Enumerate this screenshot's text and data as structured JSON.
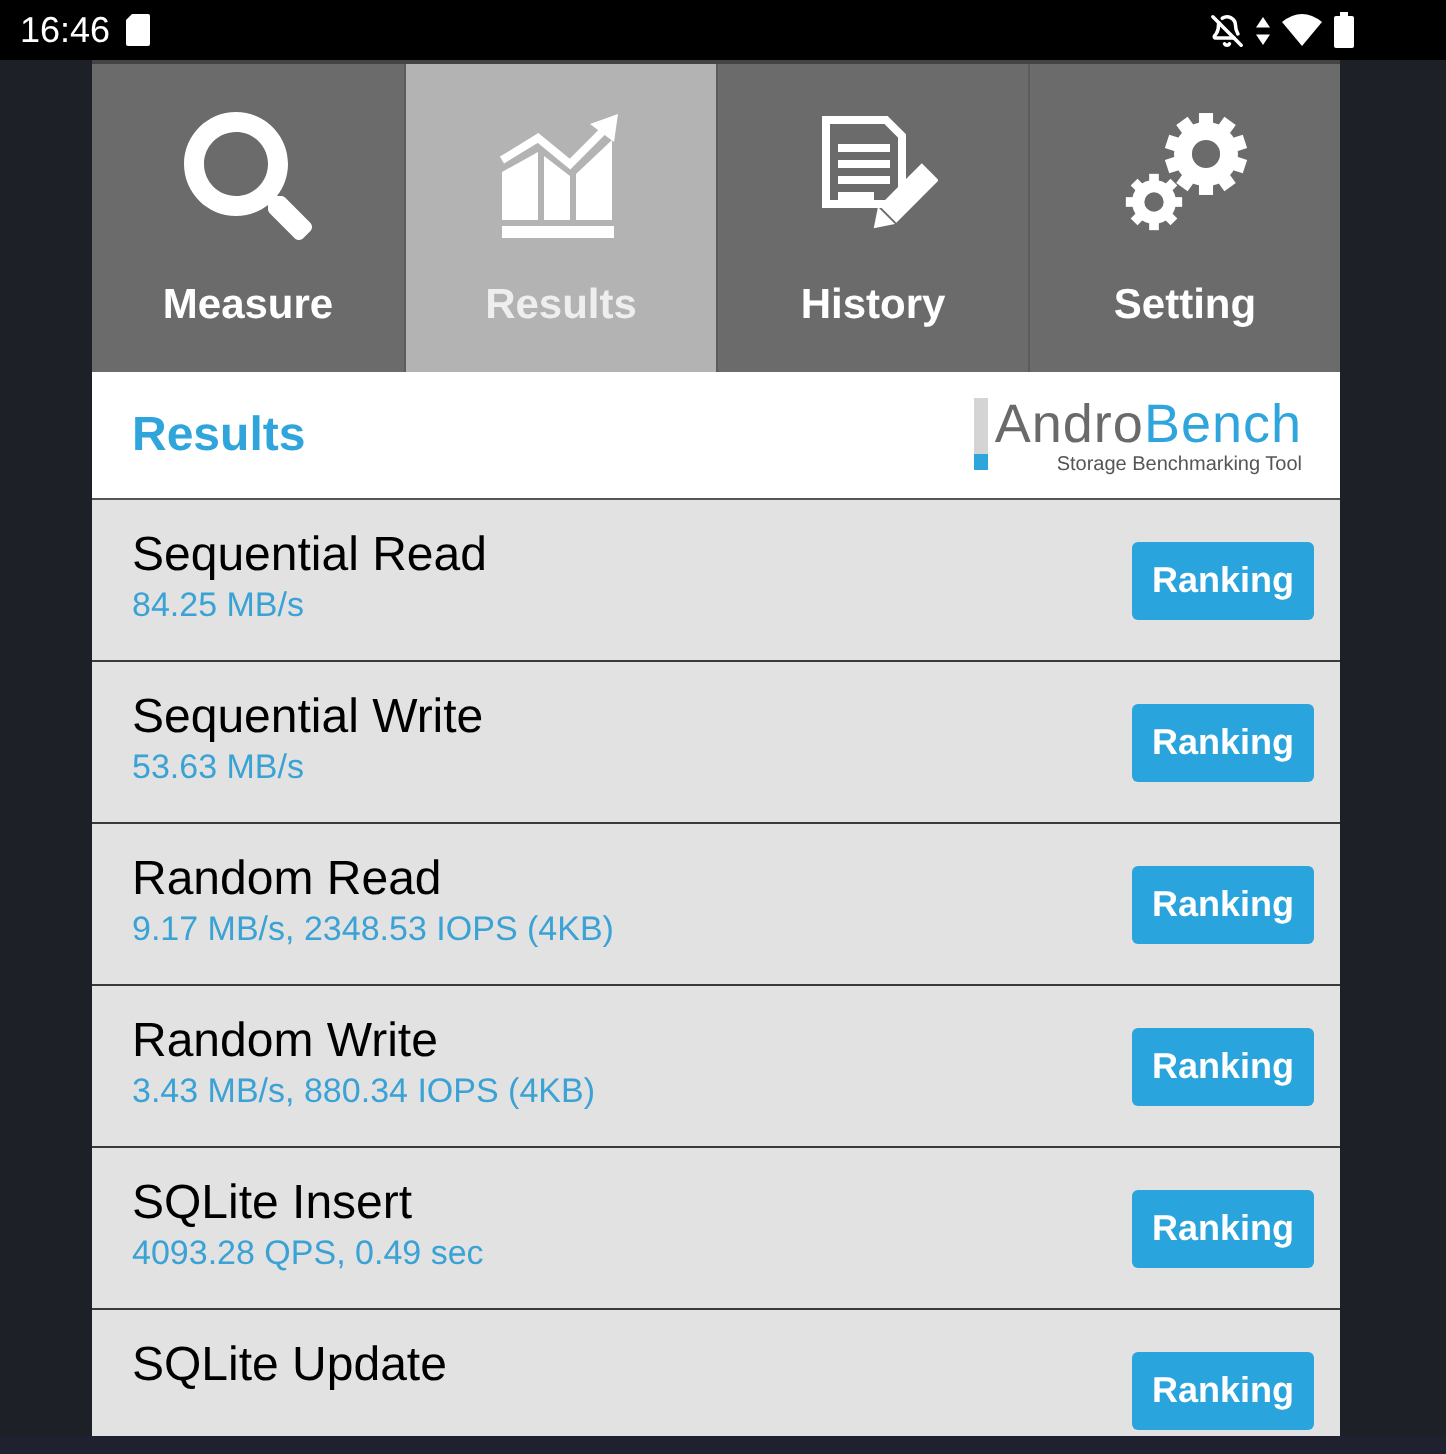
{
  "status_bar": {
    "time": "16:46"
  },
  "tabs": [
    {
      "label": "Measure",
      "selected": false
    },
    {
      "label": "Results",
      "selected": true
    },
    {
      "label": "History",
      "selected": false
    },
    {
      "label": "Setting",
      "selected": false
    }
  ],
  "header": {
    "title": "Results",
    "logo": {
      "wordmark": [
        "Andro",
        "Bench"
      ],
      "tagline": "Storage Benchmarking Tool"
    }
  },
  "results": [
    {
      "name": "Sequential Read",
      "value": "84.25 MB/s",
      "button": "Ranking"
    },
    {
      "name": "Sequential Write",
      "value": "53.63 MB/s",
      "button": "Ranking"
    },
    {
      "name": "Random Read",
      "value": "9.17 MB/s, 2348.53 IOPS (4KB)",
      "button": "Ranking"
    },
    {
      "name": "Random Write",
      "value": "3.43 MB/s, 880.34 IOPS (4KB)",
      "button": "Ranking"
    },
    {
      "name": "SQLite Insert",
      "value": "4093.28 QPS, 0.49 sec",
      "button": "Ranking"
    },
    {
      "name": "SQLite Update",
      "button": "Ranking"
    }
  ]
}
